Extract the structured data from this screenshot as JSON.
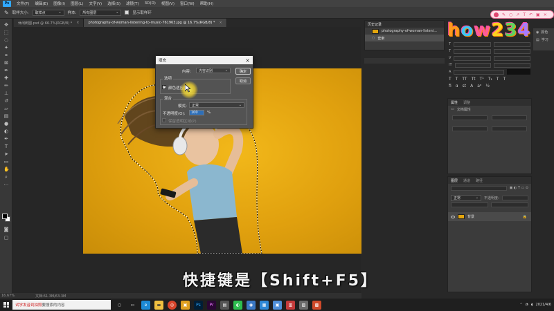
{
  "menu": {
    "app_icon": "Ps",
    "items": [
      "文件(F)",
      "编辑(E)",
      "图像(I)",
      "图层(L)",
      "文字(Y)",
      "选择(S)",
      "滤镜(T)",
      "3D(D)",
      "视图(V)",
      "窗口(W)",
      "帮助(H)"
    ]
  },
  "options_bar": {
    "sample_size_label": "取样大小:",
    "sample_size_value": "取样点",
    "sample_label": "样本:",
    "sample_value": "所有图层",
    "show_ring_label": "显示取样环"
  },
  "tabs": [
    {
      "label": "休闲刷图.psd @ 66.7%(RGB/8) *",
      "active": false
    },
    {
      "label": "photography-of-woman-listening-to-music-761963.jpg @ 16.7%(RGB/8) *",
      "active": true
    }
  ],
  "dialog": {
    "title": "填充",
    "content_label": "内容:",
    "content_value": "内容识别",
    "options_label": "选项",
    "color_adapt_label": "颜色适应(C)",
    "blend_label": "混合",
    "mode_label": "模式:",
    "mode_value": "正常",
    "opacity_label": "不透明度(O):",
    "opacity_value": "100",
    "opacity_unit": "%",
    "preserve_label": "保留透明区域(P)",
    "ok_label": "确定",
    "cancel_label": "取消"
  },
  "history_panel": {
    "tab": "历史记录",
    "items": [
      {
        "label": "photography-of-woman-listeni...",
        "selected": false
      },
      {
        "label": "套索",
        "selected": true
      }
    ]
  },
  "right_mini": {
    "items": [
      "颜色",
      "学习"
    ]
  },
  "properties_panel": {
    "tabs": [
      "属性",
      "调整"
    ],
    "doc_label": "文档属性"
  },
  "layers_panel": {
    "tabs": [
      "图层",
      "通道",
      "路径"
    ],
    "kind_value": "正常",
    "opacity_label": "不透明度:",
    "layer_name": "背景"
  },
  "watermark": {
    "text": [
      "h",
      "o",
      "w",
      "2",
      "3",
      "4"
    ],
    "colors": [
      "#ff9a1f",
      "#3ec7f4",
      "#ff5b9b",
      "#ffd21f",
      "#5fd35f",
      "#a77bff"
    ]
  },
  "subtitle": "快捷键是【Shift+F5】",
  "status": {
    "zoom": "16.67%",
    "doc": "文档:61.3M/63.3M"
  },
  "taskbar": {
    "search_highlight": "试学发音到拍照",
    "search_text": "要搜索的内容",
    "date": "2021/4/6"
  },
  "colors": {
    "canvas_yellow": "#e3a50d",
    "ps_blue": "#31a8ff"
  }
}
